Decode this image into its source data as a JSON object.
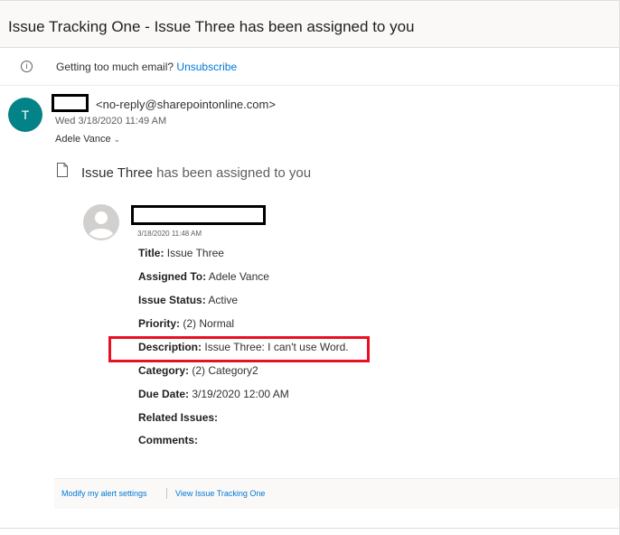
{
  "subject": "Issue Tracking One - Issue Three has been assigned to you",
  "infobar": {
    "text": "Getting too much email?",
    "link": "Unsubscribe"
  },
  "sender": {
    "initial": "T",
    "email": "<no-reply@sharepointonline.com>",
    "date": "Wed 3/18/2020 11:49 AM",
    "to": "Adele Vance"
  },
  "headline": {
    "issue": "Issue Three",
    "rest": "has been assigned to you"
  },
  "item": {
    "timestamp": "3/18/2020 11:48 AM",
    "fields": [
      {
        "label": "Title:",
        "value": "Issue Three"
      },
      {
        "label": "Assigned To:",
        "value": "Adele Vance"
      },
      {
        "label": "Issue Status:",
        "value": "Active"
      },
      {
        "label": "Priority:",
        "value": "(2) Normal"
      },
      {
        "label": "Description:",
        "value": "Issue Three: I can't use Word."
      },
      {
        "label": "Category:",
        "value": "(2) Category2"
      },
      {
        "label": "Due Date:",
        "value": "3/19/2020 12:00 AM"
      },
      {
        "label": "Related Issues:",
        "value": ""
      },
      {
        "label": "Comments:",
        "value": ""
      }
    ]
  },
  "footer": {
    "modify_link": "Modify my alert settings",
    "view_link": "View Issue Tracking One"
  },
  "colors": {
    "avatar_bg": "#038387",
    "link": "#0078d4",
    "highlight": "#e81123"
  }
}
